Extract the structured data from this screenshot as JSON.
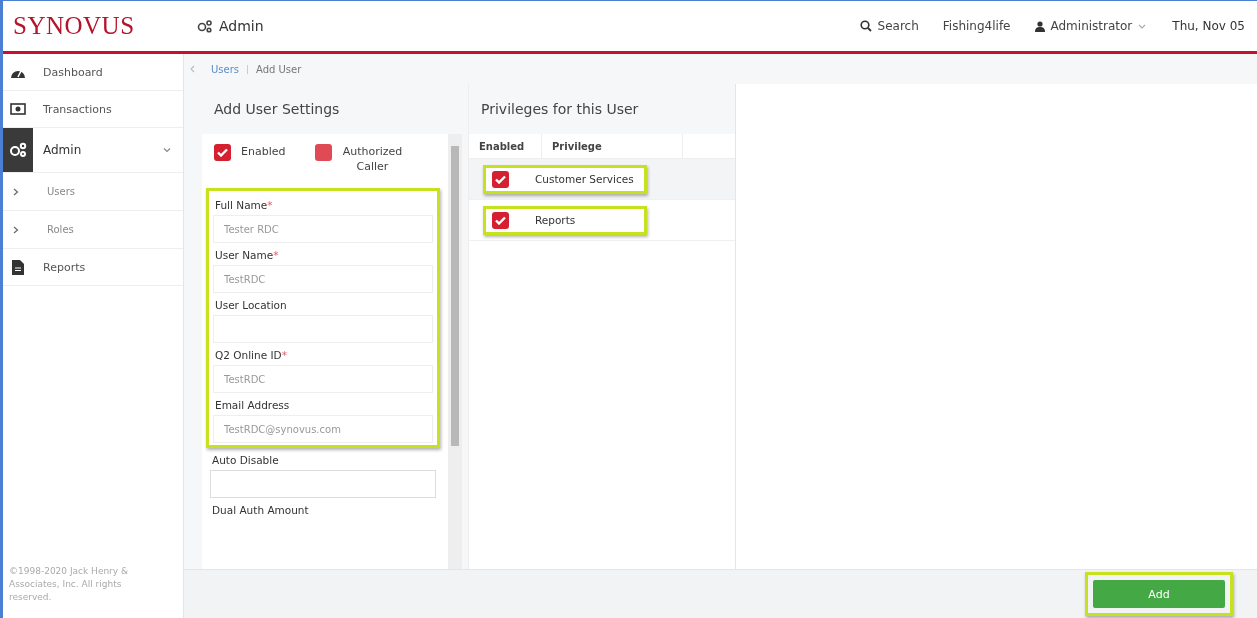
{
  "header": {
    "logo": "SYNOVUS",
    "section": "Admin",
    "search": "Search",
    "institution": "Fishing4life",
    "user": "Administrator",
    "date": "Thu, Nov 05"
  },
  "sidebar": {
    "items": [
      {
        "label": "Dashboard",
        "selected": false
      },
      {
        "label": "Transactions",
        "selected": false
      },
      {
        "label": "Admin",
        "selected": true,
        "expanded": true,
        "children": [
          {
            "label": "Users"
          },
          {
            "label": "Roles"
          }
        ]
      },
      {
        "label": "Reports",
        "selected": false
      }
    ],
    "copyright": "©1998-2020 Jack Henry & Associates, Inc. All rights reserved."
  },
  "breadcrumb": [
    "Users",
    "Add User"
  ],
  "settings": {
    "title": "Add User Settings",
    "toggles": [
      {
        "label": "Enabled",
        "checked": true
      },
      {
        "label": "Authorized Caller",
        "checked": false
      }
    ],
    "highlighted_fields": [
      {
        "label": "Full Name",
        "required_mark": "*",
        "value": "Tester RDC"
      },
      {
        "label": "User Name",
        "required_mark": "*",
        "value": "TestRDC"
      },
      {
        "label": "User Location"
      },
      {
        "label": "Q2 Online ID",
        "required_mark": "*",
        "value": "TestRDC"
      },
      {
        "label": "Email Address",
        "value": "TestRDC@synovus.com"
      }
    ],
    "other_fields": [
      {
        "label": "Auto Disable"
      },
      {
        "label": "Dual Auth Amount"
      }
    ]
  },
  "privileges": {
    "title": "Privileges for this User",
    "columns": [
      "Enabled",
      "Privilege"
    ],
    "rows": [
      {
        "name": "Customer Services",
        "checked": true,
        "highlighted": true
      },
      {
        "name": "Reports",
        "checked": true,
        "highlighted": true
      }
    ]
  },
  "add_button": {
    "label": "Add",
    "highlighted": true
  }
}
